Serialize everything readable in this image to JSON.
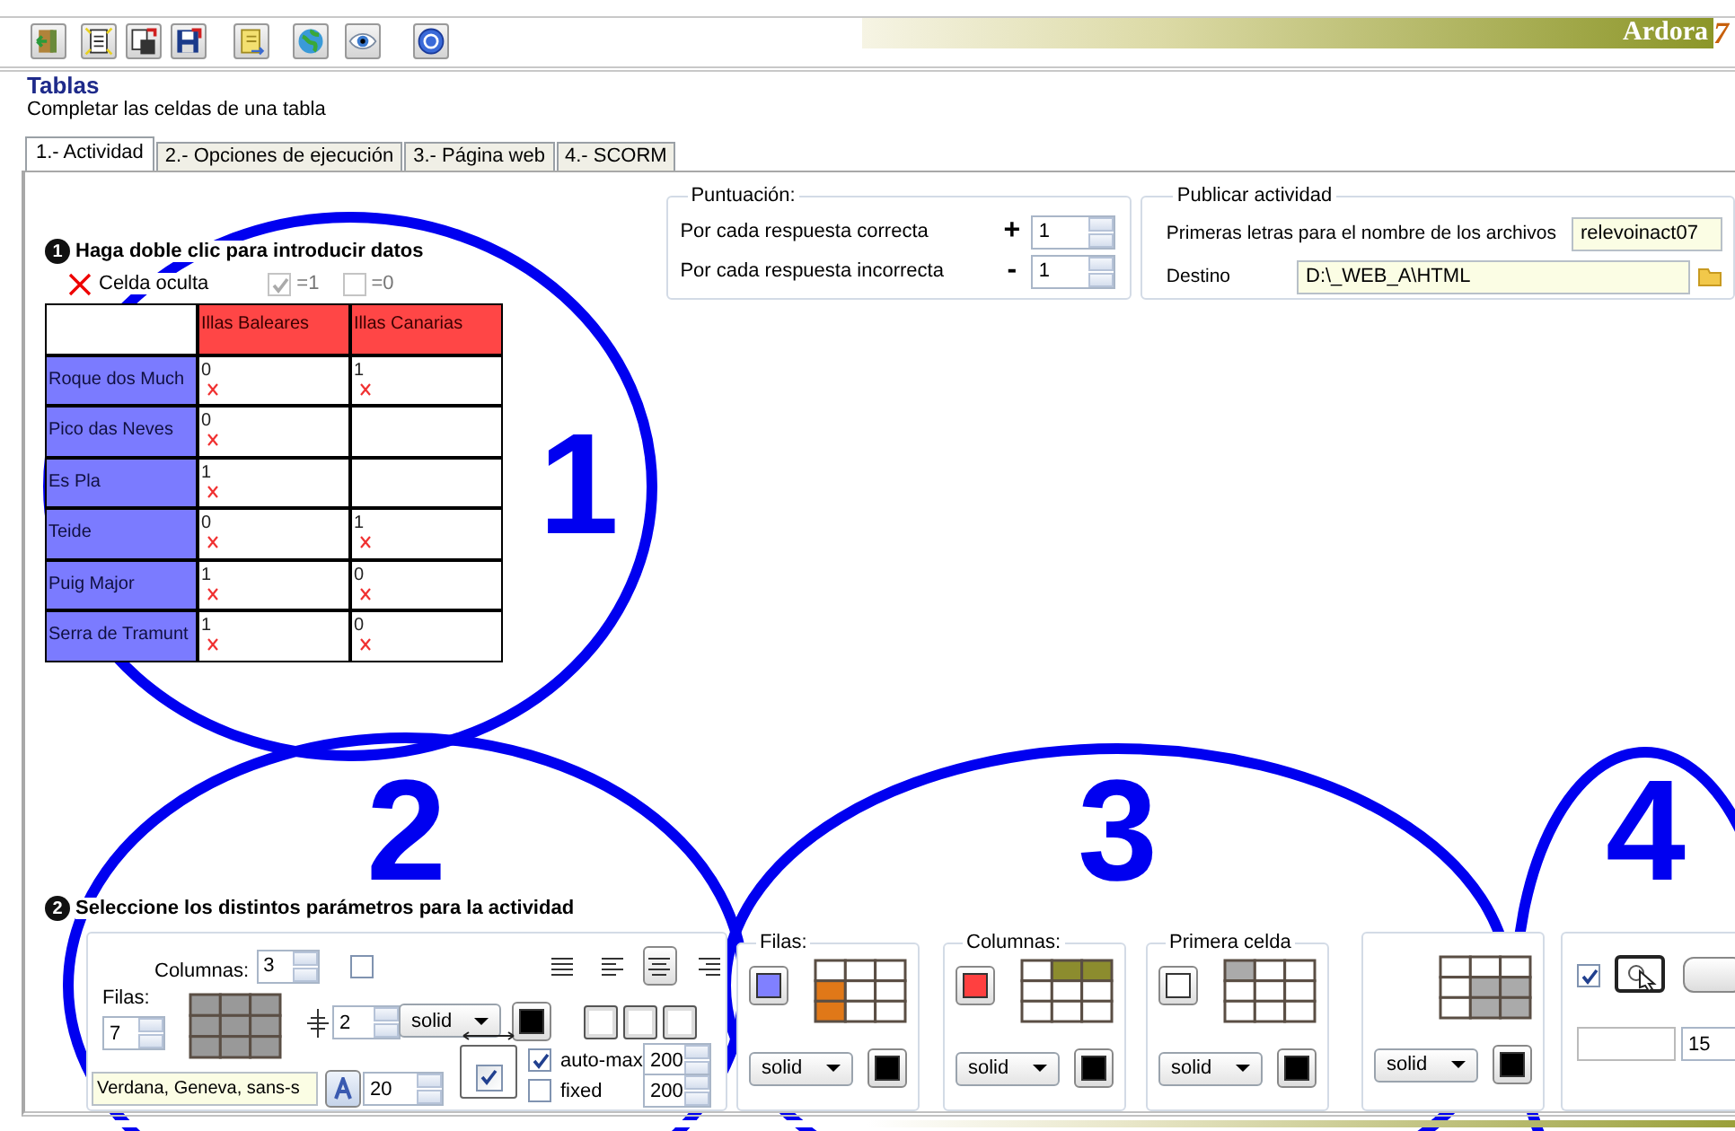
{
  "brand": {
    "name": "Ardora",
    "mark": "7"
  },
  "header": {
    "title": "Tablas",
    "subtitle": "Completar las celdas de una tabla"
  },
  "tabs": [
    {
      "label": "1.- Actividad",
      "selected": true
    },
    {
      "label": "2.- Opciones de ejecución",
      "selected": false
    },
    {
      "label": "3.- Página web",
      "selected": false
    },
    {
      "label": "4.-  SCORM",
      "selected": false
    }
  ],
  "scoring": {
    "title": "Puntuación:",
    "rows": [
      {
        "label": "Por cada respuesta correcta",
        "sign": "+",
        "value": "1"
      },
      {
        "label": "Por cada respuesta incorrecta",
        "sign": "-",
        "value": "1"
      }
    ]
  },
  "publish": {
    "title": "Publicar actividad",
    "prefix_label": "Primeras letras para el nombre de los archivos",
    "prefix_value": "relevoinact07",
    "destination_label": "Destino",
    "destination_value": "D:\\_WEB_A\\HTML"
  },
  "step1": {
    "badge": "1",
    "heading": "Haga doble clic para introducir datos",
    "hidden_label": "Celda oculta",
    "check_one": {
      "label": "=1",
      "checked": true
    },
    "check_zero": {
      "label": "=0",
      "checked": false
    }
  },
  "table": {
    "columns": [
      "Illas Baleares",
      "Illas Canarias"
    ],
    "rows": [
      {
        "label": "Roque dos Much",
        "cells": [
          {
            "value": "0",
            "hidden": true
          },
          {
            "value": "1",
            "hidden": true
          }
        ]
      },
      {
        "label": "Pico das Neves",
        "cells": [
          {
            "value": "0",
            "hidden": true
          },
          null
        ]
      },
      {
        "label": "Es Pla",
        "cells": [
          {
            "value": "1",
            "hidden": true
          },
          null
        ]
      },
      {
        "label": "Teide",
        "cells": [
          {
            "value": "0",
            "hidden": true
          },
          {
            "value": "1",
            "hidden": true
          }
        ]
      },
      {
        "label": "Puig Major",
        "cells": [
          {
            "value": "1",
            "hidden": true
          },
          {
            "value": "0",
            "hidden": true
          }
        ]
      },
      {
        "label": "Serra de Tramunt",
        "cells": [
          {
            "value": "1",
            "hidden": true
          },
          {
            "value": "0",
            "hidden": true
          }
        ]
      }
    ]
  },
  "step2": {
    "badge": "2",
    "heading": "Seleccione los distintos parámetros para la actividad"
  },
  "table_settings": {
    "columns_label": "Columnas:",
    "columns_value": "3",
    "rows_label": "Filas:",
    "rows_value": "7",
    "header_checked": false,
    "alignments": [
      {
        "selected": false
      },
      {
        "selected": false
      },
      {
        "selected": true
      },
      {
        "selected": false
      }
    ],
    "border_spinner": "2",
    "line_type": "solid",
    "font": "Verdana, Geneva, sans-s",
    "font_spinner": "20",
    "auto_max": {
      "label": "auto-max",
      "checked": true,
      "value": "200"
    },
    "fixed": {
      "label": "fixed",
      "checked": false,
      "value": "200"
    }
  },
  "style_panels": [
    {
      "kind": "rows",
      "title": "Filas:",
      "color": "#8080ff",
      "line_type": "solid"
    },
    {
      "kind": "columns",
      "title": "Columnas:",
      "color": "#ff4040",
      "line_type": "solid"
    },
    {
      "kind": "first",
      "title": "Primera celda",
      "color": "#ffffff",
      "line_type": "solid"
    },
    {
      "kind": "body",
      "line_type": "solid"
    }
  ],
  "button_panel": {
    "checked": true,
    "spinner": "15"
  },
  "annotations": [
    {
      "label": "1"
    },
    {
      "label": "2"
    },
    {
      "label": "3"
    },
    {
      "label": "4"
    }
  ]
}
